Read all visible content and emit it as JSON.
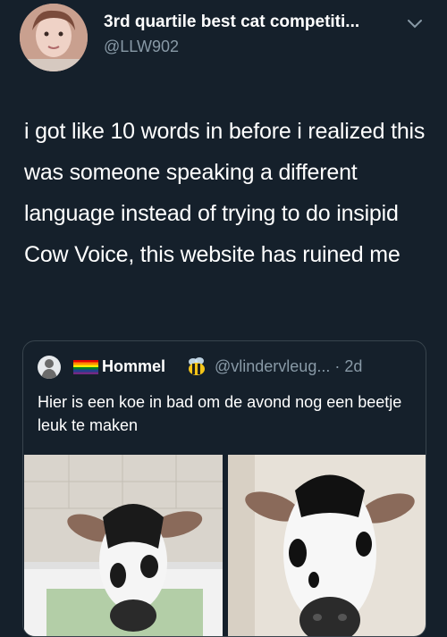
{
  "tweet": {
    "display_name": "3rd quartile best cat competiti...",
    "handle": "@LLW902",
    "text": "i got like 10 words in before i realized this was someone speaking a different language instead of trying to do insipid Cow Voice, this website has ruined me",
    "avatar_icon": "user-avatar",
    "menu_icon": "chevron-down-icon"
  },
  "quoted": {
    "display_name": "Hommel",
    "handle": "@vlindervleug...",
    "time": "· 2d",
    "text": "Hier is een koe in bad om de avond nog een beetje leuk te maken",
    "flag_icon": "rainbow-flag-icon",
    "emoji_icon": "bee-icon",
    "images": [
      "calf-in-bathtub-photo",
      "calf-face-closeup-photo"
    ]
  },
  "colors": {
    "background": "#15202b",
    "secondary_text": "#8899a6",
    "border": "#38444d"
  }
}
